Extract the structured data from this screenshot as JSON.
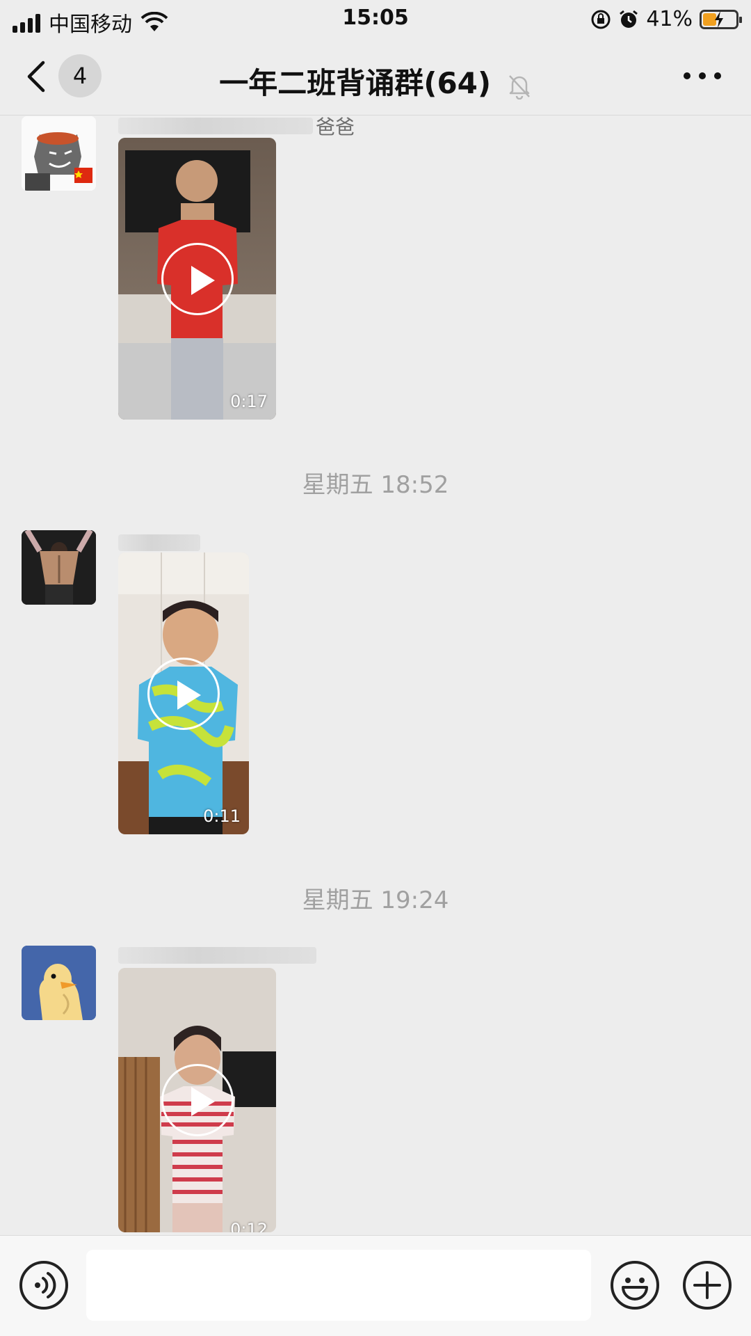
{
  "status_bar": {
    "carrier": "中国移动",
    "time": "15:05",
    "battery_percent": "41%",
    "battery_level": 0.41,
    "icons": [
      "signal-icon",
      "wifi-icon",
      "rotation-lock-icon",
      "alarm-icon",
      "battery-charging-icon"
    ]
  },
  "nav": {
    "unread_count": "4",
    "title": "一年二班背诵群(64)",
    "icons": [
      "back-chevron-icon",
      "mute-bell-icon",
      "more-dots-icon"
    ]
  },
  "messages": [
    {
      "sender_suffix": "爸爸",
      "duration": "0:17"
    },
    {
      "timestamp": "星期五 18:52"
    },
    {
      "sender_suffix": "",
      "duration": "0:11"
    },
    {
      "timestamp": "星期五 19:24"
    },
    {
      "sender_suffix": "",
      "duration": "0:12"
    }
  ],
  "input_bar": {
    "value": "",
    "icons": [
      "voice-icon",
      "emoji-icon",
      "plus-icon"
    ]
  },
  "colors": {
    "background": "#ededed",
    "battery_fill": "#f0a020",
    "timestamp_text": "#a0a0a0"
  }
}
